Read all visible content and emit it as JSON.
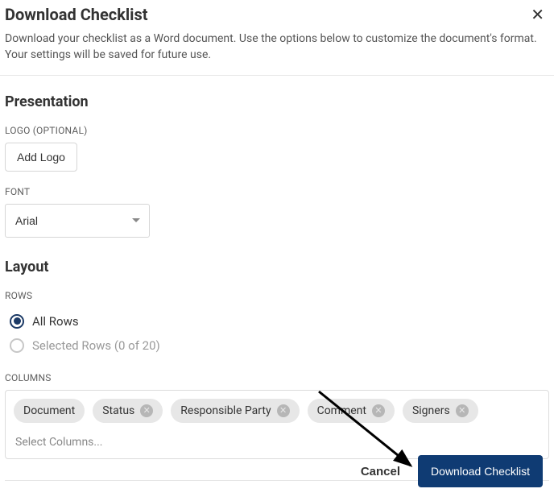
{
  "header": {
    "title": "Download Checklist",
    "description": "Download your checklist as a Word document. Use the options below to customize the document's format. Your settings will be saved for future use."
  },
  "presentation": {
    "heading": "Presentation",
    "logo": {
      "label": "LOGO (OPTIONAL)",
      "button": "Add Logo"
    },
    "font": {
      "label": "FONT",
      "value": "Arial"
    }
  },
  "layout": {
    "heading": "Layout",
    "rows": {
      "label": "ROWS",
      "options": {
        "all": "All Rows",
        "selected": "Selected Rows (0 of 20)"
      },
      "value": "all"
    },
    "columns": {
      "label": "COLUMNS",
      "chips": [
        {
          "label": "Document",
          "removable": false
        },
        {
          "label": "Status",
          "removable": true
        },
        {
          "label": "Responsible Party",
          "removable": true
        },
        {
          "label": "Comment",
          "removable": true
        },
        {
          "label": "Signers",
          "removable": true
        }
      ],
      "placeholder": "Select Columns..."
    }
  },
  "footer": {
    "cancel": "Cancel",
    "submit": "Download Checklist"
  }
}
